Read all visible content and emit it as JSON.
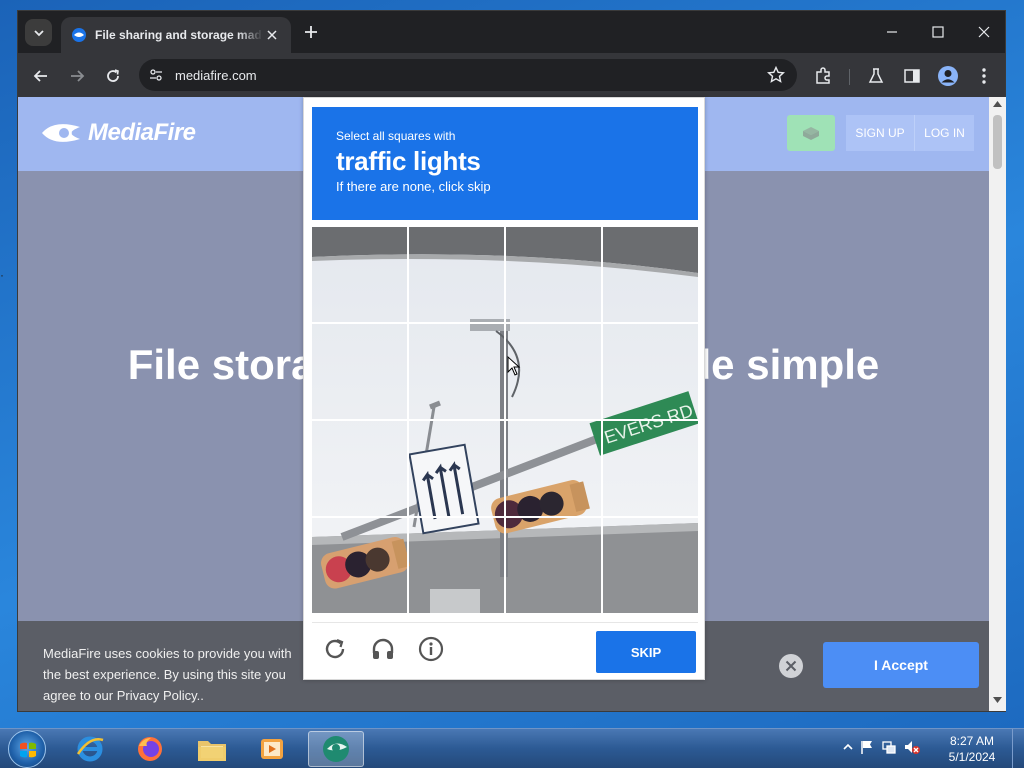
{
  "browser": {
    "tab_title": "File sharing and storage made simple",
    "url": "mediafire.com"
  },
  "site": {
    "logo_text": "MediaFire",
    "signup_label": "SIGN UP",
    "login_label": "LOG IN",
    "hero_title": "File storage and sharing made simple"
  },
  "cookie": {
    "text": "MediaFire uses cookies to provide you with the best experience. By using this site you agree to our Privacy Policy..",
    "accept_label": "I Accept"
  },
  "captcha": {
    "instruction": "Select all squares with",
    "target": "traffic lights",
    "hint": "If there are none, click skip",
    "skip_label": "SKIP"
  },
  "taskbar": {
    "time": "8:27 AM",
    "date": "5/1/2024"
  },
  "colors": {
    "captcha_blue": "#1a73e8",
    "mediafire_blue": "#3e6fe0",
    "chrome_dark": "#202124"
  }
}
